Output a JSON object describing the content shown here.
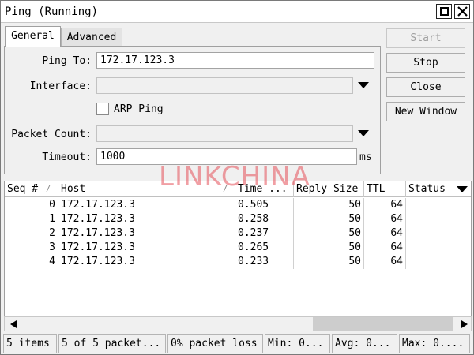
{
  "window": {
    "title": "Ping (Running)"
  },
  "tabs": [
    {
      "label": "General"
    },
    {
      "label": "Advanced"
    }
  ],
  "form": {
    "ping_to": {
      "label": "Ping To:",
      "value": "172.17.123.3"
    },
    "interface": {
      "label": "Interface:",
      "value": ""
    },
    "arp_ping": {
      "label": "ARP Ping",
      "checked": false
    },
    "packet_count": {
      "label": "Packet Count:",
      "value": ""
    },
    "timeout": {
      "label": "Timeout:",
      "value": "1000",
      "unit": "ms"
    }
  },
  "buttons": {
    "start": "Start",
    "stop": "Stop",
    "close": "Close",
    "new_window": "New Window"
  },
  "watermark": "LINKCHINA",
  "table": {
    "columns": [
      "Seq #",
      "Host",
      "Time ...",
      "Reply Size",
      "TTL",
      "Status"
    ],
    "rows": [
      {
        "seq": "0",
        "host": "172.17.123.3",
        "time": "0.505",
        "size": "50",
        "ttl": "64",
        "status": ""
      },
      {
        "seq": "1",
        "host": "172.17.123.3",
        "time": "0.258",
        "size": "50",
        "ttl": "64",
        "status": ""
      },
      {
        "seq": "2",
        "host": "172.17.123.3",
        "time": "0.237",
        "size": "50",
        "ttl": "64",
        "status": ""
      },
      {
        "seq": "3",
        "host": "172.17.123.3",
        "time": "0.265",
        "size": "50",
        "ttl": "64",
        "status": ""
      },
      {
        "seq": "4",
        "host": "172.17.123.3",
        "time": "0.233",
        "size": "50",
        "ttl": "64",
        "status": ""
      }
    ]
  },
  "status": {
    "items": "5 items",
    "packets": "5 of 5 packet...",
    "loss": "0% packet loss",
    "min": "Min: 0...",
    "avg": "Avg: 0...",
    "max": "Max: 0...."
  },
  "colors": {
    "watermark": "#e6505a",
    "background": "#f0f0f0"
  }
}
